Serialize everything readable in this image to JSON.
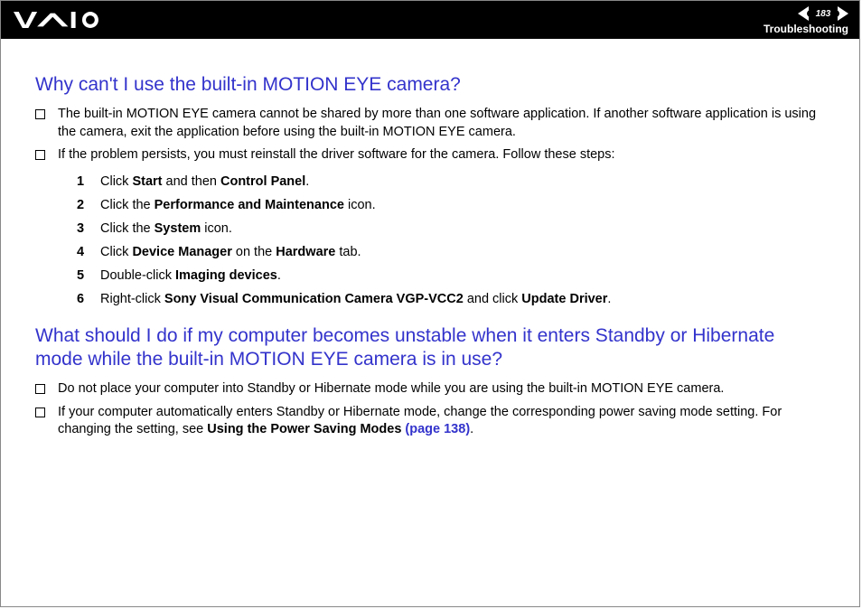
{
  "header": {
    "page_number": "183",
    "section": "Troubleshooting"
  },
  "q1": {
    "title": "Why can't I use the built-in MOTION EYE camera?",
    "bullet1": "The built-in MOTION EYE camera cannot be shared by more than one software application. If another software application is using the camera, exit the application before using the built-in MOTION EYE camera.",
    "bullet2": "If the problem persists, you must reinstall the driver software for the camera. Follow these steps:",
    "steps": {
      "s1_a": "Click ",
      "s1_b": "Start",
      "s1_c": " and then ",
      "s1_d": "Control Panel",
      "s1_e": ".",
      "s2_a": "Click the ",
      "s2_b": "Performance and Maintenance",
      "s2_c": " icon.",
      "s3_a": "Click the ",
      "s3_b": "System",
      "s3_c": " icon.",
      "s4_a": "Click ",
      "s4_b": "Device Manager",
      "s4_c": " on the ",
      "s4_d": "Hardware",
      "s4_e": " tab.",
      "s5_a": "Double-click ",
      "s5_b": "Imaging devices",
      "s5_c": ".",
      "s6_a": "Right-click ",
      "s6_b": "Sony Visual Communication Camera VGP-VCC2",
      "s6_c": " and click ",
      "s6_d": "Update Driver",
      "s6_e": "."
    }
  },
  "q2": {
    "title": "What should I do if my computer becomes unstable when it enters Standby or Hibernate mode while the built-in MOTION EYE camera is in use?",
    "bullet1": "Do not place your computer into Standby or Hibernate mode while you are using the built-in MOTION EYE camera.",
    "bullet2_a": "If your computer automatically enters Standby or Hibernate mode, change the corresponding power saving mode setting. For changing the setting, see ",
    "bullet2_b": "Using the Power Saving Modes ",
    "bullet2_c": "(page 138)",
    "bullet2_d": "."
  }
}
